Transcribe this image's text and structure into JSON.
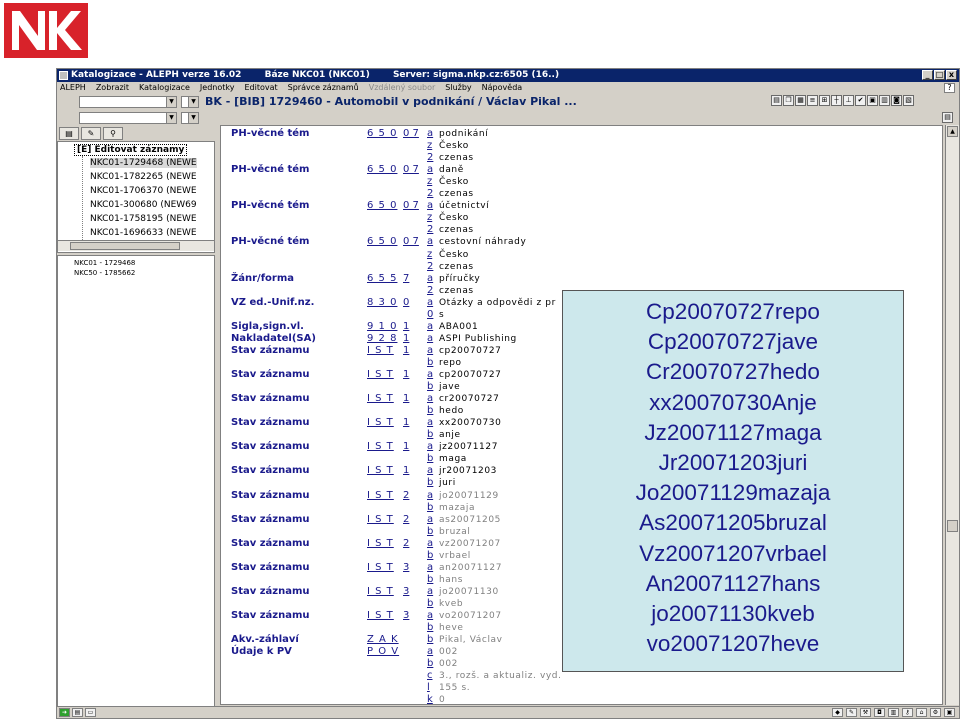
{
  "window": {
    "title_parts": [
      "Katalogizace - ALEPH verze 16.02",
      "Báze NKC01 (NKC01)",
      "Server: sigma.nkp.cz:6505 (16..)"
    ],
    "controls": [
      "_",
      "□",
      "x"
    ]
  },
  "menu": [
    "ALEPH",
    "Zobrazit",
    "Katalogizace",
    "Jednotky",
    "Editovat",
    "Správce záznamů",
    "Vzdálený soubor",
    "Služby",
    "Nápověda"
  ],
  "menu_disabled": [
    "Vzdálený soubor"
  ],
  "record_header": "BK - [BIB] 1729460 - Automobil v podnikání / Václav Pikal ...",
  "left_panel": {
    "header": "[E] Editovat záznamy",
    "items": [
      "NKC01-1729468 (NEWE",
      "NKC01-1782265 (NEWE",
      "NKC01-1706370 (NEWE",
      "NKC01-300680 (NEW69",
      "NKC01-1758195 (NEWE",
      "NKC01-1696633 (NEWE"
    ],
    "tree2": [
      "NKC01 - 1729468",
      "NKC50 - 1785662"
    ]
  },
  "record_fields": [
    {
      "label": "PH-věcné tém",
      "tag": "6 5 0",
      "ind": "0 7",
      "sub": "a",
      "val": "podnikání"
    },
    {
      "label": "",
      "tag": "",
      "ind": "",
      "sub": "z",
      "val": "Česko"
    },
    {
      "label": "",
      "tag": "",
      "ind": "",
      "sub": "2",
      "val": "czenas"
    },
    {
      "label": "PH-věcné tém",
      "tag": "6 5 0",
      "ind": "0 7",
      "sub": "a",
      "val": "daně"
    },
    {
      "label": "",
      "tag": "",
      "ind": "",
      "sub": "z",
      "val": "Česko"
    },
    {
      "label": "",
      "tag": "",
      "ind": "",
      "sub": "2",
      "val": "czenas"
    },
    {
      "label": "PH-věcné tém",
      "tag": "6 5 0",
      "ind": "0 7",
      "sub": "a",
      "val": "účetnictví"
    },
    {
      "label": "",
      "tag": "",
      "ind": "",
      "sub": "z",
      "val": "Česko"
    },
    {
      "label": "",
      "tag": "",
      "ind": "",
      "sub": "2",
      "val": "czenas"
    },
    {
      "label": "PH-věcné tém",
      "tag": "6 5 0",
      "ind": "0 7",
      "sub": "a",
      "val": "cestovní náhrady"
    },
    {
      "label": "",
      "tag": "",
      "ind": "",
      "sub": "z",
      "val": "Česko"
    },
    {
      "label": "",
      "tag": "",
      "ind": "",
      "sub": "2",
      "val": "czenas"
    },
    {
      "label": "Žánr/forma",
      "tag": "6 5 5",
      "ind": "  7",
      "sub": "a",
      "val": "příručky"
    },
    {
      "label": "",
      "tag": "",
      "ind": "",
      "sub": "2",
      "val": "czenas"
    },
    {
      "label": "VZ ed.-Unif.nz.",
      "tag": "8 3 0",
      "ind": "  0",
      "sub": "a",
      "val": "Otázky a odpovědi z pr"
    },
    {
      "label": "",
      "tag": "",
      "ind": "",
      "sub": "0",
      "val": "s"
    },
    {
      "label": "Sigla,sign.vl.",
      "tag": "9 1 0",
      "ind": "1",
      "sub": "a",
      "val": "ABA001"
    },
    {
      "label": "Nakladatel(SA)",
      "tag": "9 2 8",
      "ind": "1",
      "sub": "a",
      "val": "ASPI Publishing"
    },
    {
      "label": "Stav záznamu",
      "tag": "I S T",
      "ind": "1",
      "sub": "a",
      "val": "cp20070727"
    },
    {
      "label": "",
      "tag": "",
      "ind": "",
      "sub": "b",
      "val": "repo"
    },
    {
      "label": "Stav záznamu",
      "tag": "I S T",
      "ind": "1",
      "sub": "a",
      "val": "cp20070727"
    },
    {
      "label": "",
      "tag": "",
      "ind": "",
      "sub": "b",
      "val": "jave"
    },
    {
      "label": "Stav záznamu",
      "tag": "I S T",
      "ind": "1",
      "sub": "a",
      "val": "cr20070727"
    },
    {
      "label": "",
      "tag": "",
      "ind": "",
      "sub": "b",
      "val": "hedo"
    },
    {
      "label": "Stav záznamu",
      "tag": "I S T",
      "ind": "1",
      "sub": "a",
      "val": "xx20070730"
    },
    {
      "label": "",
      "tag": "",
      "ind": "",
      "sub": "b",
      "val": "anje"
    },
    {
      "label": "Stav záznamu",
      "tag": "I S T",
      "ind": "1",
      "sub": "a",
      "val": "jz20071127"
    },
    {
      "label": "",
      "tag": "",
      "ind": "",
      "sub": "b",
      "val": "maga"
    },
    {
      "label": "Stav záznamu",
      "tag": "I S T",
      "ind": "1",
      "sub": "a",
      "val": "jr20071203"
    },
    {
      "label": "",
      "tag": "",
      "ind": "",
      "sub": "b",
      "val": "juri"
    },
    {
      "label": "Stav záznamu",
      "tag": "I S T",
      "ind": "2",
      "sub": "a",
      "val": "jo20071129",
      "dim": true
    },
    {
      "label": "",
      "tag": "",
      "ind": "",
      "sub": "b",
      "val": "mazaja",
      "dim": true
    },
    {
      "label": "Stav záznamu",
      "tag": "I S T",
      "ind": "2",
      "sub": "a",
      "val": "as20071205",
      "dim": true
    },
    {
      "label": "",
      "tag": "",
      "ind": "",
      "sub": "b",
      "val": "bruzal",
      "dim": true
    },
    {
      "label": "Stav záznamu",
      "tag": "I S T",
      "ind": "2",
      "sub": "a",
      "val": "vz20071207",
      "dim": true
    },
    {
      "label": "",
      "tag": "",
      "ind": "",
      "sub": "b",
      "val": "vrbael",
      "dim": true
    },
    {
      "label": "Stav záznamu",
      "tag": "I S T",
      "ind": "3",
      "sub": "a",
      "val": "an20071127",
      "dim": true
    },
    {
      "label": "",
      "tag": "",
      "ind": "",
      "sub": "b",
      "val": "hans",
      "dim": true
    },
    {
      "label": "Stav záznamu",
      "tag": "I S T",
      "ind": "3",
      "sub": "a",
      "val": "jo20071130",
      "dim": true
    },
    {
      "label": "",
      "tag": "",
      "ind": "",
      "sub": "b",
      "val": "kveb",
      "dim": true
    },
    {
      "label": "Stav záznamu",
      "tag": "I S T",
      "ind": "3",
      "sub": "a",
      "val": "vo20071207",
      "dim": true
    },
    {
      "label": "",
      "tag": "",
      "ind": "",
      "sub": "b",
      "val": "heve",
      "dim": true
    },
    {
      "label": "Akv.-záhlaví",
      "tag": "Z A K",
      "ind": "",
      "sub": "b",
      "val": "Pikal, Václav",
      "dim": true
    },
    {
      "label": "Údaje k PV",
      "tag": "P O V",
      "ind": "",
      "sub": "a",
      "val": "002",
      "dim": true
    },
    {
      "label": "",
      "tag": "",
      "ind": "",
      "sub": "b",
      "val": "002",
      "dim": true
    },
    {
      "label": "",
      "tag": "",
      "ind": "",
      "sub": "c",
      "val": "3., rozš. a aktualiz. vyd.",
      "dim": true
    },
    {
      "label": "",
      "tag": "",
      "ind": "",
      "sub": "l",
      "val": "155 s.",
      "dim": true
    },
    {
      "label": "",
      "tag": "",
      "ind": "",
      "sub": "k",
      "val": "0",
      "dim": true
    }
  ],
  "overlay_lines": [
    "Cp20070727repo",
    "Cp20070727jave",
    "Cr20070727hedo",
    "xx20070730Anje",
    "Jz20071127maga",
    "Jr20071203juri",
    "Jo20071129mazaja",
    "As20071205bruzal",
    "Vz20071207vrbael",
    "An20071127hans",
    "jo20071130kveb",
    "vo20071207heve"
  ],
  "colors": {
    "logo_red": "#d8222a",
    "titlebar": "#0a246a",
    "field_blue": "#1a1a8c",
    "overlay_bg": "#cde8ec"
  }
}
